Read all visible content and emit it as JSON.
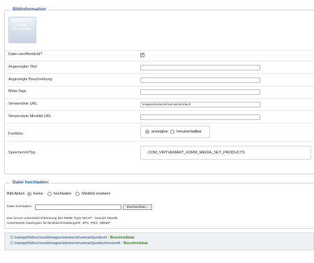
{
  "bildinfo": {
    "legend": "Bildinformation",
    "thumb": {
      "line1": "PRODUCT",
      "line2": "Image",
      "line3": "Unavailable"
    },
    "published_label": "Datei veröffentlicht?",
    "title_label": "Angezeigter Titel",
    "title_value": "",
    "desc_label": "Angezeigte Beschreibung",
    "desc_value": "",
    "meta_label": "Meta-Tags",
    "meta_value": "",
    "url_label": "Verwendete URL",
    "url_value": "images/stories/virtuemart/product/",
    "thumburl_label": "Verwendete Miniblid URL",
    "thumburl_value": "",
    "function_label": "Funktion",
    "function_opt1": "anzeigbar",
    "function_opt2": "herunterladbar",
    "location_label": "Speicherort/Typ",
    "location_value": "COM_VIRTUEMART_FORM_MEDIA_SET_PRODUCTS"
  },
  "upload": {
    "legend": "Datei hochladen:",
    "action_label": "Bild Aktion",
    "action_opt1": "Keine",
    "action_opt2": "hochladen",
    "action_opt3": "Miniblid ersetzen",
    "file_label": "Datei hochladen:",
    "browse_label": "Durchsuchen...",
    "note1": "Der Server unterstützt Erkennung des MIME-Typs NICHT - benutzt Tabelle.",
    "note2": "Unterstützte Dateitypen für Miniblid-ErstellungGIF, JPG, PNG, WBMP"
  },
  "paths": {
    "path1": "C:\\xampp\\htdocs\\rural\\images\\stories\\virtuemart\\product\\ :",
    "status1": "Beschreibbar",
    "path2": "C:\\xampp\\htdocs\\rural\\images\\stories\\virtuemart\\product\\resized\\ :",
    "status2": "Beschreibbar"
  }
}
